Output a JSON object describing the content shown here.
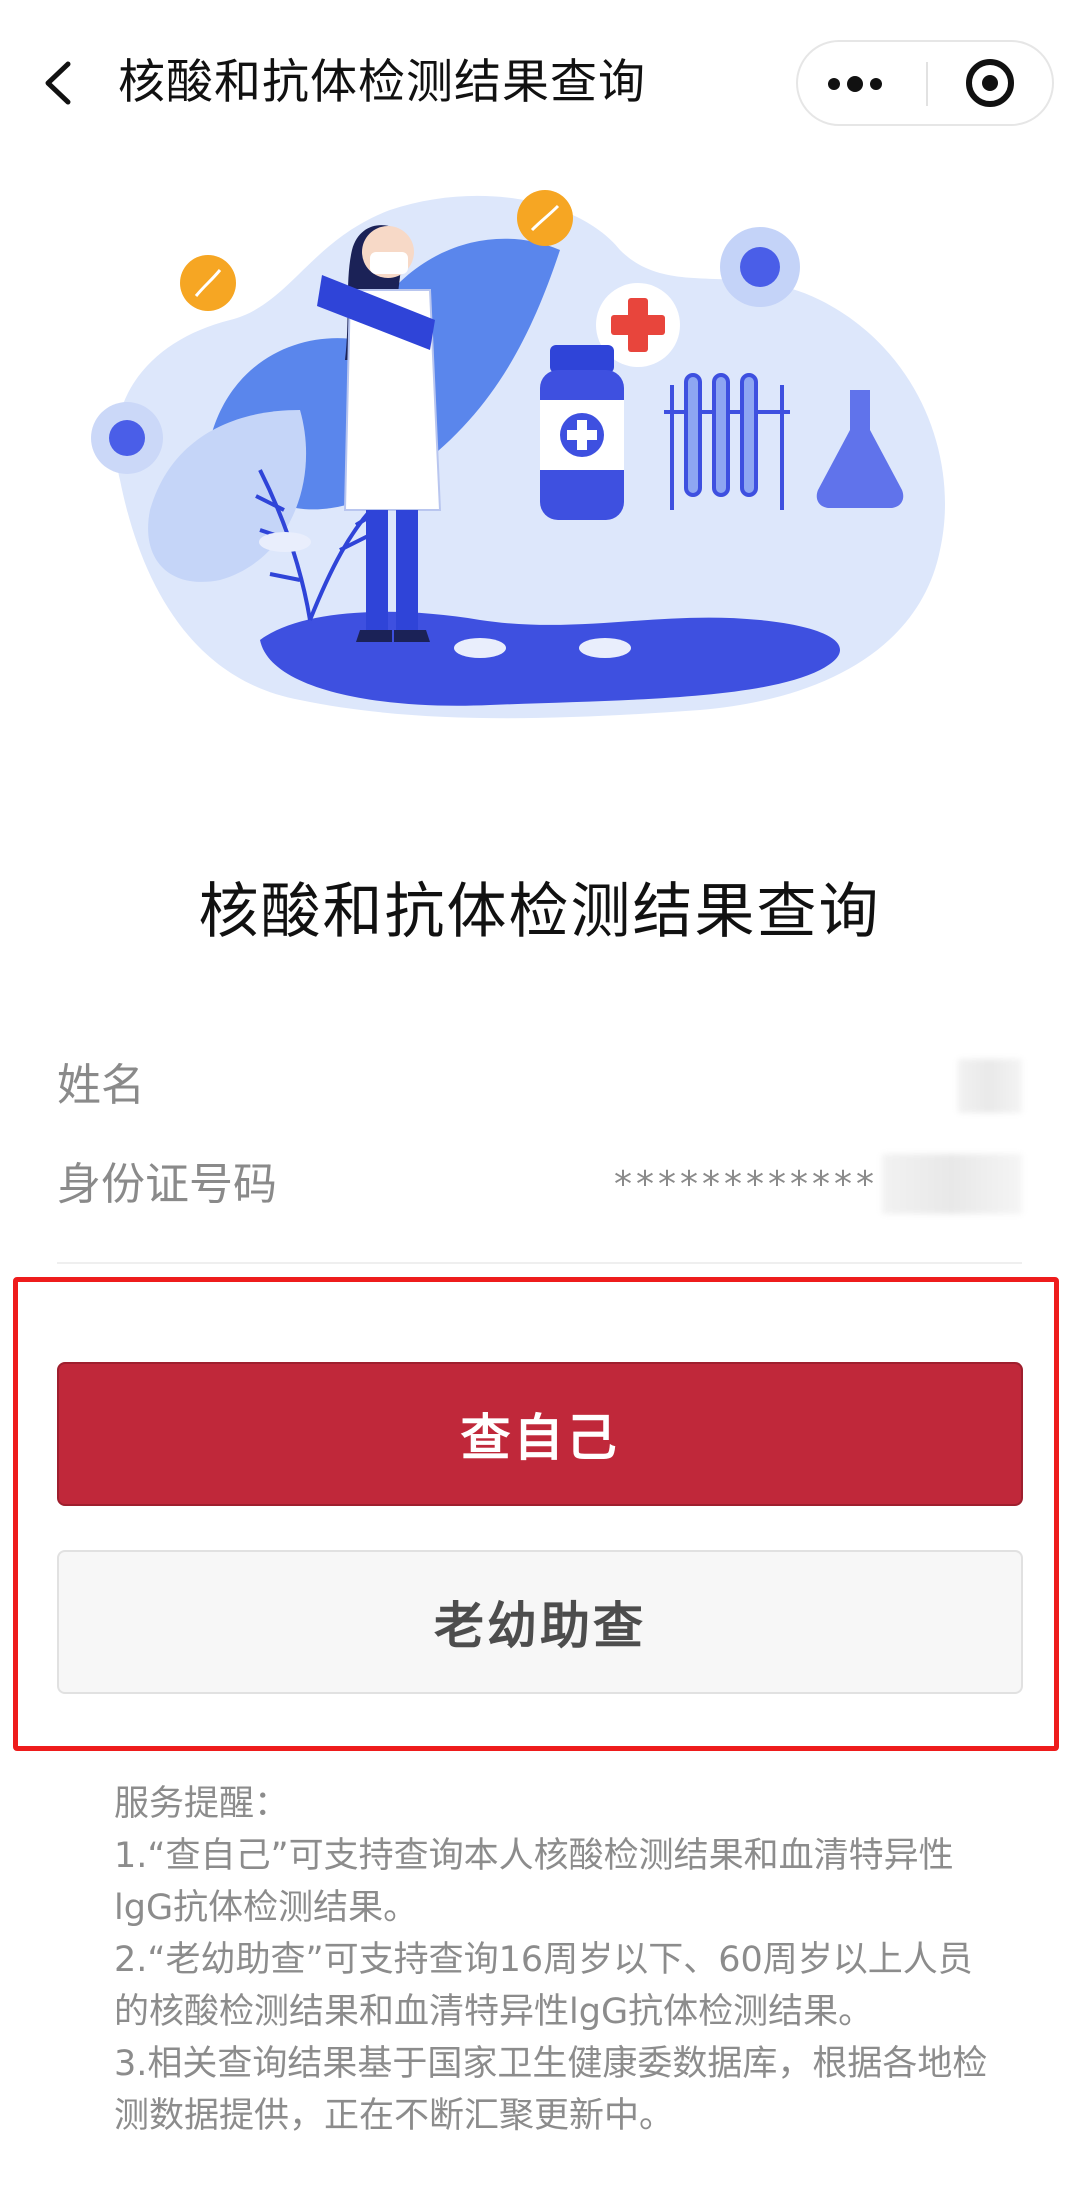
{
  "navbar": {
    "title": "核酸和抗体检测结果查询"
  },
  "icons": {
    "back": "chevron-left-icon",
    "more": "more-dots-icon",
    "close": "target-circle-icon"
  },
  "main": {
    "title": "核酸和抗体检测结果查询"
  },
  "form": {
    "name_label": "姓名",
    "name_value": "",
    "id_label": "身份证号码",
    "id_value": "************"
  },
  "buttons": {
    "self_query": "查自己",
    "assist_query": "老幼助查"
  },
  "notes": {
    "heading": "服务提醒：",
    "item1": "1.“查自己”可支持查询本人核酸检测结果和血清特异性lgG抗体检测结果。",
    "item2": "2.“老幼助查”可支持查询16周岁以下、60周岁以上人员的核酸检测结果和血清特异性lgG抗体检测结果。",
    "item3": "3.相关查询结果基于国家卫生健康委数据库，根据各地检测数据提供，正在不断汇聚更新中。"
  },
  "colors": {
    "primary_button": "#c0283a",
    "secondary_button": "#f7f7f7",
    "highlight_frame": "#ee1c1c",
    "illustration_blue": "#4a5ee8",
    "illustration_light": "#dde7fb",
    "accent_orange": "#f6a623",
    "cross_red": "#e8453c"
  }
}
